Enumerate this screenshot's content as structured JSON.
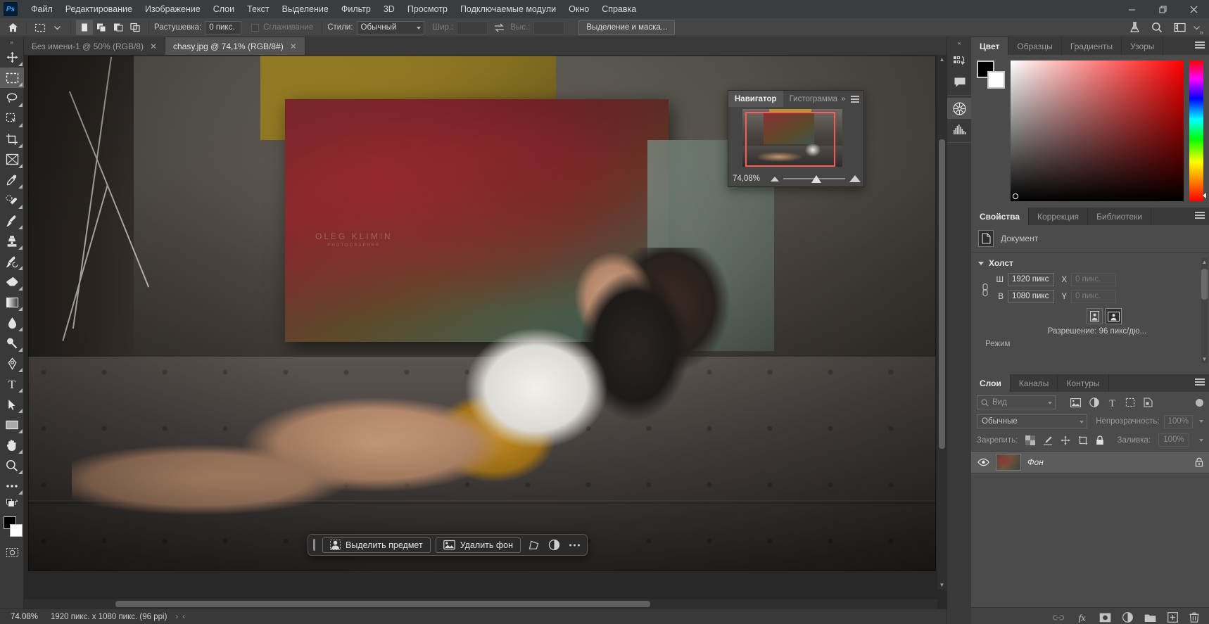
{
  "app": {
    "logo": "Ps",
    "menus": [
      "Файл",
      "Редактирование",
      "Изображение",
      "Слои",
      "Текст",
      "Выделение",
      "Фильтр",
      "3D",
      "Просмотр",
      "Подключаемые модули",
      "Окно",
      "Справка"
    ],
    "window_controls": {
      "minimize": "—",
      "maximize": "❐",
      "close": "✕"
    }
  },
  "options_bar": {
    "home_icon": "home-icon",
    "tool_preset": "marquee-tool-preset",
    "feather_label": "Растушевка:",
    "feather_value": "0 пикс.",
    "antialias_label": "Сглаживание",
    "style_label": "Стили:",
    "style_value": "Обычный",
    "width_label": "Шир.:",
    "width_value": "",
    "height_label": "Выс.:",
    "height_value": "",
    "select_mask_button": "Выделение и маска...",
    "right_icons": [
      "beaker-icon",
      "search-icon",
      "workspace-icon",
      "chevron-down-icon"
    ]
  },
  "toolbar": {
    "collapse": "»",
    "tools": [
      {
        "name": "move-tool",
        "label": "Перемещение"
      },
      {
        "name": "rectangular-marquee-tool",
        "label": "Прямоугольная область",
        "selected": true
      },
      {
        "name": "lasso-tool",
        "label": "Лассо"
      },
      {
        "name": "quick-selection-tool",
        "label": "Быстрое выделение"
      },
      {
        "name": "crop-tool",
        "label": "Рамка"
      },
      {
        "name": "frame-tool",
        "label": "Кадр"
      },
      {
        "name": "eyedropper-tool",
        "label": "Пипетка"
      },
      {
        "name": "healing-brush-tool",
        "label": "Восстанавливающая кисть"
      },
      {
        "name": "brush-tool",
        "label": "Кисть"
      },
      {
        "name": "clone-stamp-tool",
        "label": "Штамп"
      },
      {
        "name": "history-brush-tool",
        "label": "Архивная кисть"
      },
      {
        "name": "eraser-tool",
        "label": "Ластик"
      },
      {
        "name": "gradient-tool",
        "label": "Градиент"
      },
      {
        "name": "blur-tool",
        "label": "Размытие"
      },
      {
        "name": "dodge-tool",
        "label": "Осветлитель"
      },
      {
        "name": "pen-tool",
        "label": "Перо"
      },
      {
        "name": "type-tool",
        "label": "Текст"
      },
      {
        "name": "path-selection-tool",
        "label": "Выделение контура"
      },
      {
        "name": "rectangle-tool",
        "label": "Прямоугольник"
      },
      {
        "name": "hand-tool",
        "label": "Рука"
      },
      {
        "name": "zoom-tool",
        "label": "Масштаб"
      },
      {
        "name": "edit-toolbar-tool",
        "label": "Редактировать панель инструментов"
      }
    ],
    "foreground_color": "#000000",
    "background_color": "#ffffff"
  },
  "tabs": [
    {
      "title": "Без имени-1 @ 50% (RGB/8)",
      "active": false,
      "close": "✕"
    },
    {
      "title": "chasy.jpg @ 74,1% (RGB/8#)",
      "active": true,
      "close": "✕"
    }
  ],
  "canvas": {
    "watermark_name": "OLEG KLIMIN",
    "watermark_sub": "PHOTOGRAPHER"
  },
  "contextual_task_bar": {
    "select_subject": "Выделить предмет",
    "remove_background": "Удалить фон",
    "transform_icon": "transform-icon",
    "adjustment_icon": "adjustment-icon",
    "more_icon": "more-options-icon"
  },
  "status_bar": {
    "zoom": "74.08%",
    "doc_info": "1920 пикс. x 1080 пикс. (96 ppi)",
    "next_arrow": "›",
    "prev_arrow": "‹"
  },
  "navigator": {
    "tabs": [
      {
        "label": "Навигатор",
        "active": true
      },
      {
        "label": "Гистограмма",
        "active": false
      }
    ],
    "more": "»",
    "zoom_value": "74,08%",
    "zoom_out_icon": "zoom-out-icon",
    "zoom_in_icon": "zoom-in-icon"
  },
  "dock_rail": {
    "collapse": "«",
    "buttons": [
      {
        "name": "history-icon",
        "selected": false
      },
      {
        "name": "comments-icon",
        "selected": false
      },
      {
        "name": "adjustments-icon",
        "selected": true
      },
      {
        "name": "histogram-icon",
        "selected": false
      }
    ]
  },
  "color_panel": {
    "tabs": [
      {
        "label": "Цвет",
        "active": true
      },
      {
        "label": "Образцы",
        "active": false
      },
      {
        "label": "Градиенты",
        "active": false
      },
      {
        "label": "Узоры",
        "active": false
      }
    ],
    "collapse_arrows": "»",
    "menu_icon": "panel-menu-icon",
    "foreground": "#000000",
    "background": "#ffffff"
  },
  "properties_panel": {
    "tabs": [
      {
        "label": "Свойства",
        "active": true
      },
      {
        "label": "Коррекция",
        "active": false
      },
      {
        "label": "Библиотеки",
        "active": false
      }
    ],
    "doc_row": "Документ",
    "section": "Холст",
    "width_label": "Ш",
    "width_value": "1920 пикс",
    "x_label": "X",
    "x_value": "0 пикс.",
    "height_label": "В",
    "height_value": "1080 пикс",
    "y_label": "Y",
    "y_value": "0 пикс.",
    "orientation_portrait": "portrait-icon",
    "orientation_landscape": "landscape-icon",
    "resolution": "Разрешение: 96 пикс/дю...",
    "mode": "Режим"
  },
  "layers_panel": {
    "tabs": [
      {
        "label": "Слои",
        "active": true
      },
      {
        "label": "Каналы",
        "active": false
      },
      {
        "label": "Контуры",
        "active": false
      }
    ],
    "search_placeholder": "Вид",
    "filter_icons": [
      "image-filter-icon",
      "adjustment-filter-icon",
      "type-filter-icon",
      "shape-filter-icon",
      "smart-object-filter-icon"
    ],
    "blend_mode": "Обычные",
    "opacity_label": "Непрозрачность:",
    "opacity_value": "100%",
    "lock_label": "Закрепить:",
    "lock_icons": [
      "lock-transparency-icon",
      "lock-pixels-icon",
      "lock-position-icon",
      "lock-artboard-icon",
      "lock-all-icon"
    ],
    "fill_label": "Заливка:",
    "fill_value": "100%",
    "layers": [
      {
        "name": "Фон",
        "visible": true,
        "locked": true
      }
    ],
    "bottom_icons": [
      "link-layers-icon",
      "layer-style-icon",
      "layer-mask-icon",
      "adjustment-layer-icon",
      "new-group-icon",
      "new-layer-icon",
      "delete-layer-icon"
    ]
  }
}
